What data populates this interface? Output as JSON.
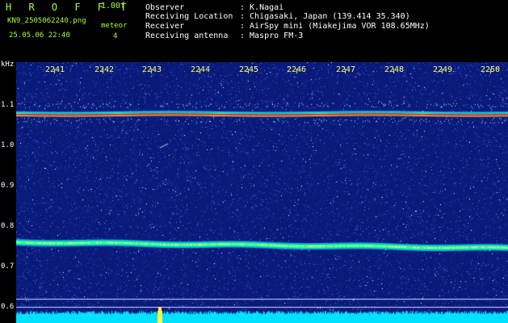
{
  "header": {
    "logo": "H R O F F T",
    "version": "1.00f",
    "filename": "KN9_2505062240.png",
    "meteor_label": "meteor",
    "meteor_count": "4",
    "datetime": "25.05.06 22:40",
    "info": [
      {
        "label": "Observer",
        "value": ": K.Nagai"
      },
      {
        "label": "Receiving Location",
        "value": ": Chigasaki, Japan (139.414 35.340)"
      },
      {
        "label": "Receiver",
        "value": ": AirSpy mini (Miakejima VOR 108.65MHz)"
      },
      {
        "label": "Receiving antenna",
        "value": ": Maspro FM-3"
      }
    ]
  },
  "spectrogram": {
    "y_unit": "kHz",
    "y_ticks": [
      "1.1",
      "1.0",
      "0.9",
      "0.8",
      "0.7",
      "0.6"
    ],
    "x_ticks": [
      "2241",
      "2242",
      "2243",
      "2244",
      "2245",
      "2246",
      "2247",
      "2248",
      "2249",
      "2250"
    ],
    "colors": {
      "background": "#0a1a7a",
      "accent": "#a8ff3c",
      "trace": "#00e0ff"
    }
  }
}
